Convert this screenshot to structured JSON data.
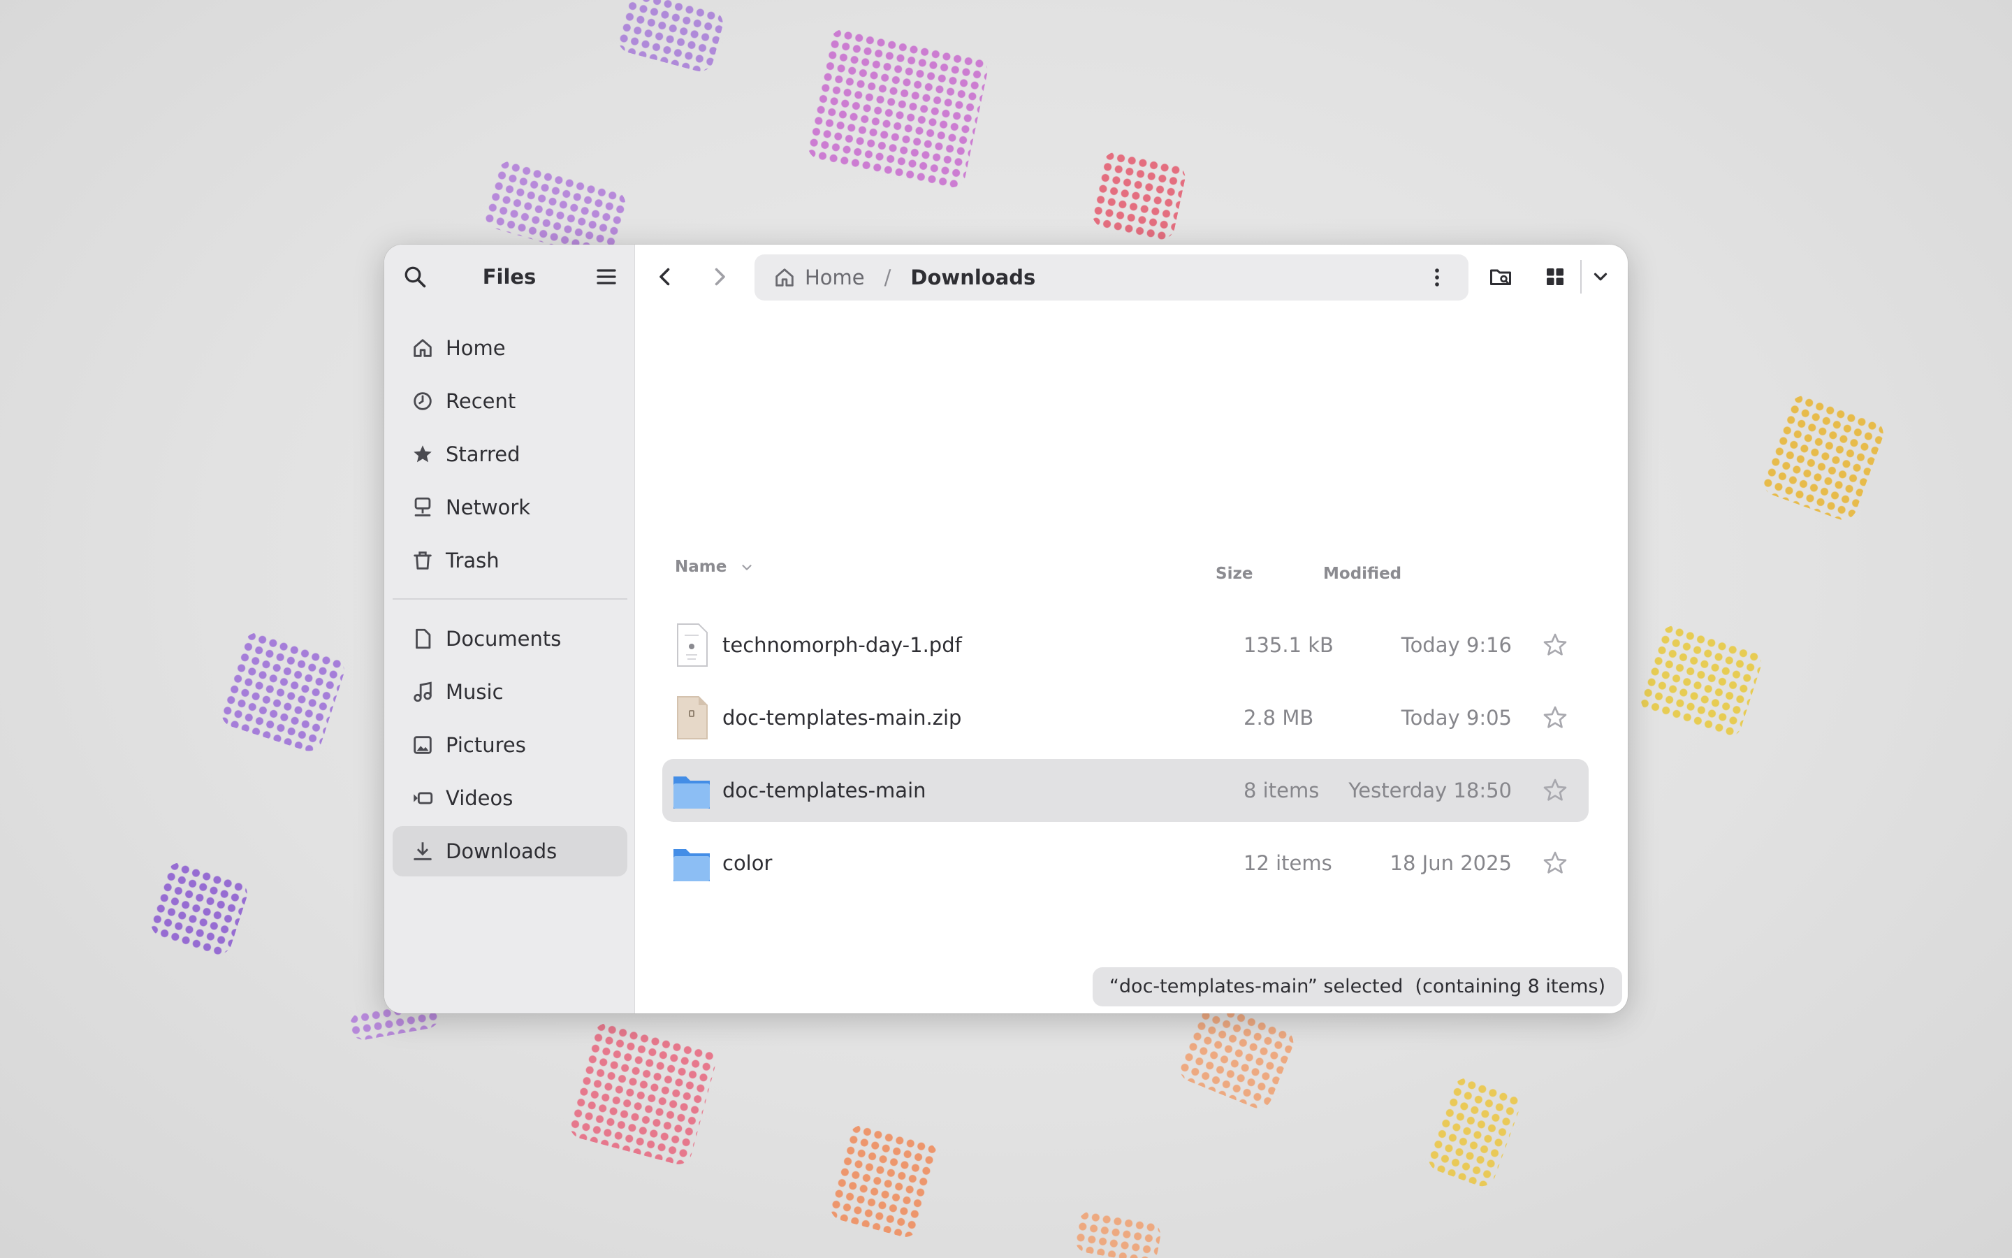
{
  "sidebar": {
    "title": "Files",
    "places": [
      {
        "label": "Home",
        "icon": "home-icon"
      },
      {
        "label": "Recent",
        "icon": "clock-icon"
      },
      {
        "label": "Starred",
        "icon": "star-icon"
      },
      {
        "label": "Network",
        "icon": "network-icon"
      },
      {
        "label": "Trash",
        "icon": "trash-icon"
      }
    ],
    "bookmarks": [
      {
        "label": "Documents",
        "icon": "document-icon"
      },
      {
        "label": "Music",
        "icon": "music-icon"
      },
      {
        "label": "Pictures",
        "icon": "picture-icon"
      },
      {
        "label": "Videos",
        "icon": "video-icon"
      },
      {
        "label": "Downloads",
        "icon": "download-icon",
        "active": true
      }
    ]
  },
  "pathbar": {
    "home": "Home",
    "separator": "/",
    "current": "Downloads"
  },
  "columns": {
    "name": "Name",
    "size": "Size",
    "modified": "Modified"
  },
  "files": [
    {
      "name": "technomorph-day-1.pdf",
      "size": "135.1 kB",
      "modified": "Today 9:16",
      "type": "pdf",
      "selected": false
    },
    {
      "name": "doc-templates-main.zip",
      "size": "2.8 MB",
      "modified": "Today 9:05",
      "type": "zip",
      "selected": false
    },
    {
      "name": "doc-templates-main",
      "size": "8 items",
      "modified": "Yesterday 18:50",
      "type": "folder",
      "selected": true
    },
    {
      "name": "color",
      "size": "12 items",
      "modified": "18 Jun 2025",
      "type": "folder",
      "selected": false
    }
  ],
  "status": "“doc-templates-main” selected  (containing 8 items)",
  "colors": {
    "accent_folder": "#62a0ea",
    "selected_row": "#e1e1e3",
    "sidebar_bg": "#ebebed"
  }
}
